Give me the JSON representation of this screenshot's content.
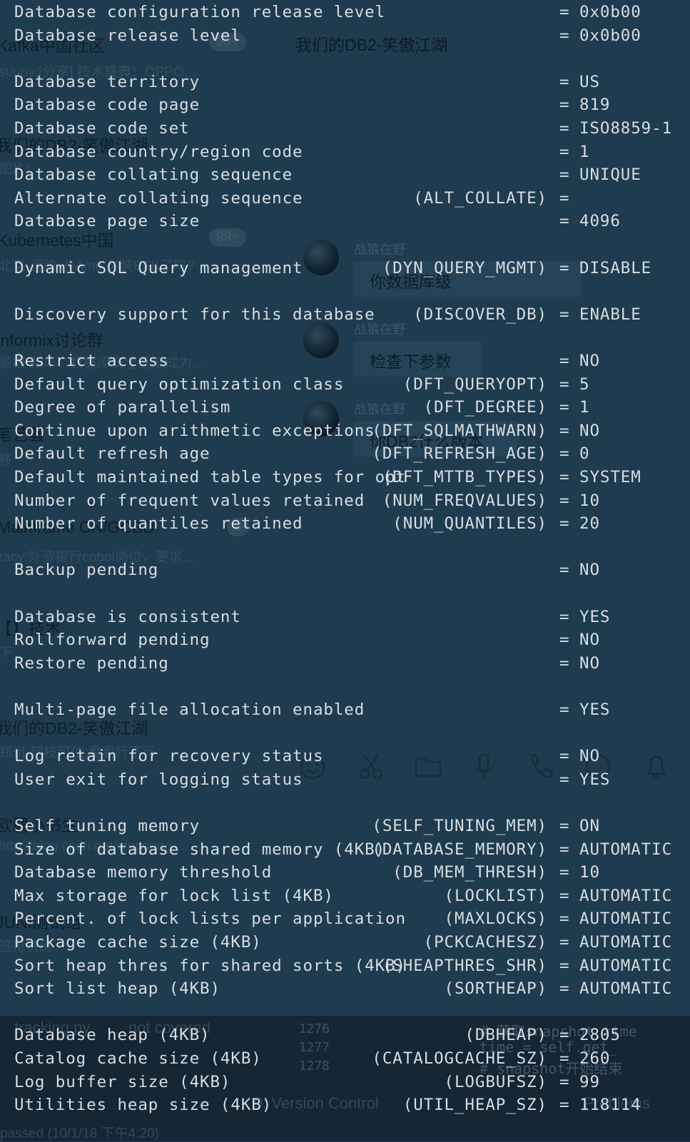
{
  "background_app": {
    "left_chats": [
      {
        "title": "Kafka中国社区",
        "preview": "suupy:[分享] 技术盛典：OPPO…",
        "badge": "99+"
      },
      {
        "title": "我们的DB2-笑傲江湖",
        "preview": "图片]"
      },
      {
        "title": "Kubernetes中国",
        "preview": "北京-运维 @Amo 你装EFK了吗?",
        "badge": "99+"
      },
      {
        "title": "Informix讨论群",
        "preview": "景根 新华：数据库安全逐渐成为…"
      },
      {
        "title": "笔艺荟",
        "preview": "移"
      },
      {
        "title": "Mainframe CN/GCBD",
        "preview": "racy:外资银行cobol岗位，要求…",
        "badge": "9"
      },
      {
        "title": "【】技术",
        "preview": "下"
      },
      {
        "title": "我们的DB2-笑傲江湖",
        "preview": "郑州-何枝可依:看看行不行"
      },
      {
        "title": "欧弱小书生",
        "preview": "http://blog.csdn.net/qingsong…"
      },
      {
        "title": "JUNI测试组",
        "preview": "签抢资历"
      }
    ],
    "chat_header": "我们的DB2-笑傲江湖",
    "messages": [
      {
        "sender": "战狼在野",
        "text": "你数据库级"
      },
      {
        "sender": "战狼在野",
        "text": "检查下参数"
      },
      {
        "sender": "战狼在野",
        "text": "你DB2什么版本"
      }
    ],
    "ide": {
      "file": "tracking.py",
      "status": "not covered",
      "line_numbers": [
        "1276",
        "1277",
        "1278"
      ],
      "code": [
        "# 获取snapshot time",
        "time = self.get_",
        "# snapshot开始结束"
      ],
      "tabs": [
        "9: Version Control",
        "Problems"
      ],
      "status_bar": "passed (10/1/18 下午4:20)"
    }
  },
  "terminal": {
    "rows": [
      {
        "label": "Database configuration release level",
        "param": "",
        "value": "0x0b00",
        "eq": true
      },
      {
        "label": "Database release level",
        "param": "",
        "value": "0x0b00",
        "eq": true
      },
      null,
      {
        "label": "Database territory",
        "param": "",
        "value": "US",
        "eq": true
      },
      {
        "label": "Database code page",
        "param": "",
        "value": "819",
        "eq": true
      },
      {
        "label": "Database code set",
        "param": "",
        "value": "ISO8859-1",
        "eq": true
      },
      {
        "label": "Database country/region code",
        "param": "",
        "value": "1",
        "eq": true
      },
      {
        "label": "Database collating sequence",
        "param": "",
        "value": "UNIQUE",
        "eq": true
      },
      {
        "label": "Alternate collating sequence",
        "param": "(ALT_COLLATE)",
        "value": "",
        "eq": true
      },
      {
        "label": "Database page size",
        "param": "",
        "value": "4096",
        "eq": true
      },
      null,
      {
        "label": "Dynamic SQL Query management",
        "param": "(DYN_QUERY_MGMT)",
        "value": "DISABLE",
        "eq": true
      },
      null,
      {
        "label": "Discovery support for this database",
        "param": "(DISCOVER_DB)",
        "value": "ENABLE",
        "eq": true
      },
      null,
      {
        "label": "Restrict access",
        "param": "",
        "value": "NO",
        "eq": true
      },
      {
        "label": "Default query optimization class",
        "param": "(DFT_QUERYOPT)",
        "value": "5",
        "eq": true
      },
      {
        "label": "Degree of parallelism",
        "param": "(DFT_DEGREE)",
        "value": "1",
        "eq": true
      },
      {
        "label": "Continue upon arithmetic exceptions",
        "param": "(DFT_SQLMATHWARN)",
        "value": "NO",
        "eq": true
      },
      {
        "label": "Default refresh age",
        "param": "(DFT_REFRESH_AGE)",
        "value": "0",
        "eq": true
      },
      {
        "label": "Default maintained table types for opt",
        "param": "(DFT_MTTB_TYPES)",
        "value": "SYSTEM",
        "eq": true
      },
      {
        "label": "Number of frequent values retained",
        "param": "(NUM_FREQVALUES)",
        "value": "10",
        "eq": true
      },
      {
        "label": "Number of quantiles retained",
        "param": "(NUM_QUANTILES)",
        "value": "20",
        "eq": true
      },
      null,
      {
        "label": "Backup pending",
        "param": "",
        "value": "NO",
        "eq": true
      },
      null,
      {
        "label": "Database is consistent",
        "param": "",
        "value": "YES",
        "eq": true
      },
      {
        "label": "Rollforward pending",
        "param": "",
        "value": "NO",
        "eq": true
      },
      {
        "label": "Restore pending",
        "param": "",
        "value": "NO",
        "eq": true
      },
      null,
      {
        "label": "Multi-page file allocation enabled",
        "param": "",
        "value": "YES",
        "eq": true
      },
      null,
      {
        "label": "Log retain for recovery status",
        "param": "",
        "value": "NO",
        "eq": true
      },
      {
        "label": "User exit for logging status",
        "param": "",
        "value": "YES",
        "eq": true
      },
      null,
      {
        "label": "Self tuning memory",
        "param": "(SELF_TUNING_MEM)",
        "value": "ON",
        "eq": true
      },
      {
        "label": "Size of database shared memory (4KB)",
        "param": "(DATABASE_MEMORY)",
        "value": "AUTOMATIC",
        "eq": true
      },
      {
        "label": "Database memory threshold",
        "param": "(DB_MEM_THRESH)",
        "value": "10",
        "eq": true
      },
      {
        "label": "Max storage for lock list (4KB)",
        "param": "(LOCKLIST)",
        "value": "AUTOMATIC",
        "eq": true
      },
      {
        "label": "Percent. of lock lists per application",
        "param": "(MAXLOCKS)",
        "value": "AUTOMATIC",
        "eq": true
      },
      {
        "label": "Package cache size (4KB)",
        "param": "(PCKCACHESZ)",
        "value": "AUTOMATIC",
        "eq": true
      },
      {
        "label": "Sort heap thres for shared sorts (4KB)",
        "param": "(SHEAPTHRES_SHR)",
        "value": "AUTOMATIC",
        "eq": true
      },
      {
        "label": "Sort list heap (4KB)",
        "param": "(SORTHEAP)",
        "value": "AUTOMATIC",
        "eq": true
      },
      null,
      {
        "label": "Database heap (4KB)",
        "param": "(DBHEAP)",
        "value": "2805",
        "eq": true
      },
      {
        "label": "Catalog cache size (4KB)",
        "param": "(CATALOGCACHE_SZ)",
        "value": "260",
        "eq": true
      },
      {
        "label": "Log buffer size (4KB)",
        "param": "(LOGBUFSZ)",
        "value": "99",
        "eq": true
      },
      {
        "label": "Utilities heap size (4KB)",
        "param": "(UTIL_HEAP_SZ)",
        "value": "118114",
        "eq": true
      }
    ]
  }
}
